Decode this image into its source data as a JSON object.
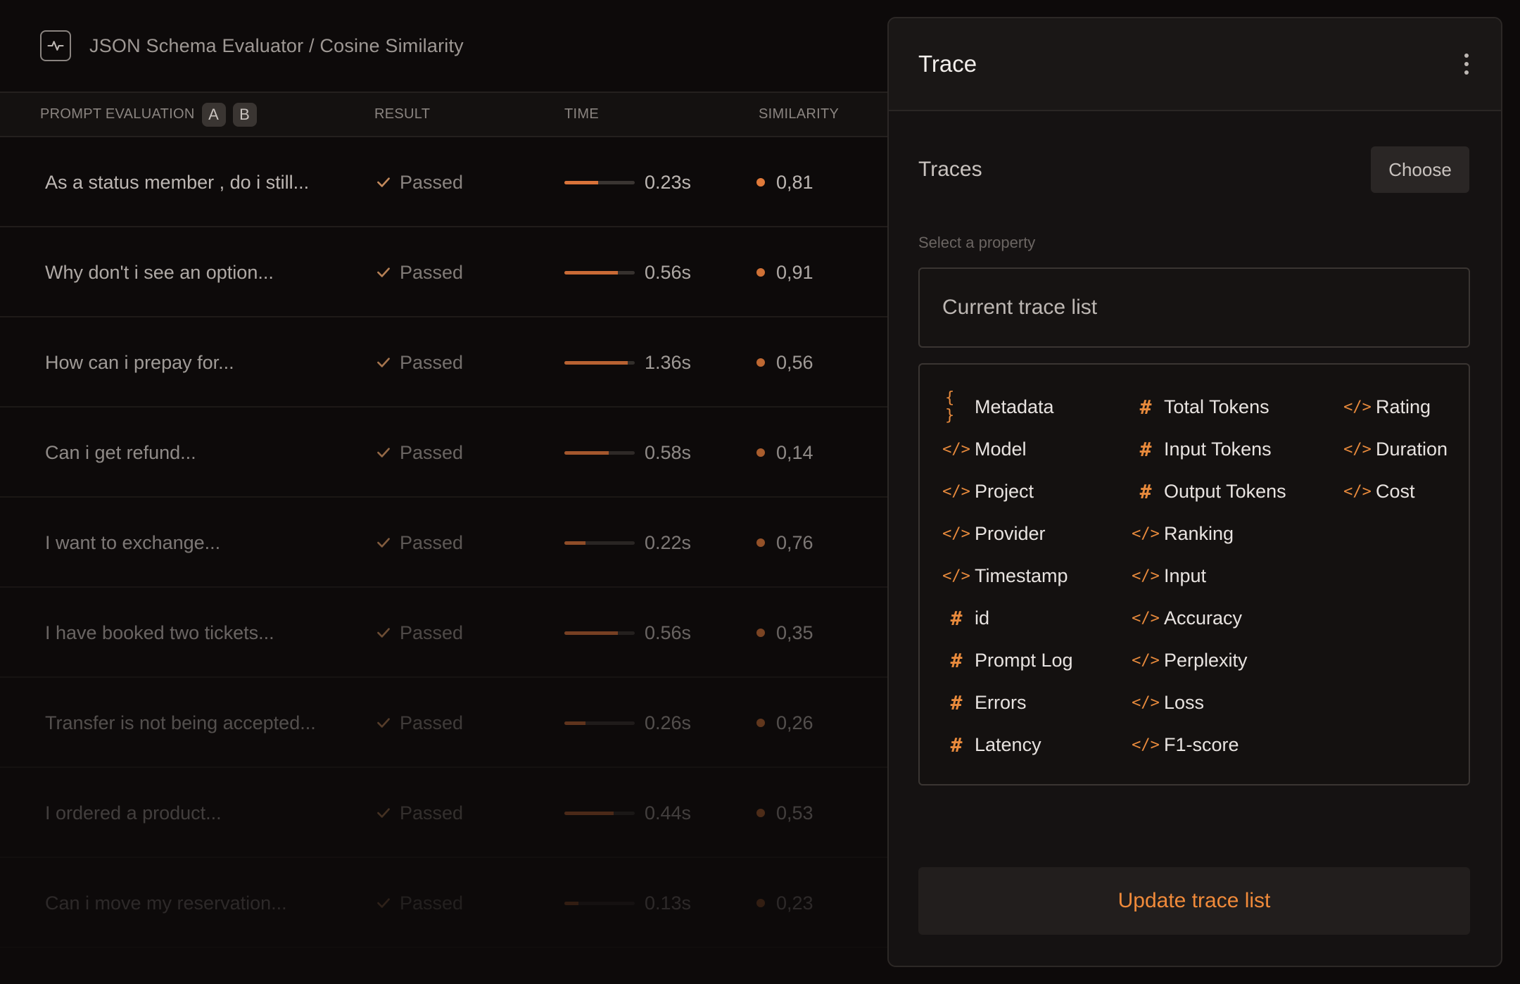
{
  "header": {
    "breadcrumb": "JSON Schema Evaluator / Cosine Similarity"
  },
  "table": {
    "columns": {
      "prompt": "PROMPT EVALUATION",
      "badge_a": "A",
      "badge_b": "B",
      "result": "RESULT",
      "time": "TIME",
      "similarity": "SIMILARITY"
    },
    "rows": [
      {
        "prompt": "As a status member , do i still...",
        "result": "Passed",
        "time": "0.23s",
        "bar": 0.48,
        "similarity": "0,81",
        "opacity": 1.0
      },
      {
        "prompt": "Why don't i see an option...",
        "result": "Passed",
        "time": "0.56s",
        "bar": 0.76,
        "similarity": "0,91",
        "opacity": 0.92
      },
      {
        "prompt": "How can i prepay for...",
        "result": "Passed",
        "time": "1.36s",
        "bar": 0.9,
        "similarity": "0,56",
        "opacity": 0.84
      },
      {
        "prompt": "Can i get refund...",
        "result": "Passed",
        "time": "0.58s",
        "bar": 0.63,
        "similarity": "0,14",
        "opacity": 0.74
      },
      {
        "prompt": "I want to exchange...",
        "result": "Passed",
        "time": "0.22s",
        "bar": 0.3,
        "similarity": "0,76",
        "opacity": 0.64
      },
      {
        "prompt": "I have booked two tickets...",
        "result": "Passed",
        "time": "0.56s",
        "bar": 0.76,
        "similarity": "0,35",
        "opacity": 0.52
      },
      {
        "prompt": "Transfer is not being accepted...",
        "result": "Passed",
        "time": "0.26s",
        "bar": 0.3,
        "similarity": "0,26",
        "opacity": 0.4
      },
      {
        "prompt": "I ordered a product...",
        "result": "Passed",
        "time": "0.44s",
        "bar": 0.7,
        "similarity": "0,53",
        "opacity": 0.3
      },
      {
        "prompt": "Can i move my reservation...",
        "result": "Passed",
        "time": "0.13s",
        "bar": 0.2,
        "similarity": "0,23",
        "opacity": 0.18
      }
    ]
  },
  "panel": {
    "title": "Trace",
    "traces_label": "Traces",
    "choose_label": "Choose",
    "select_label": "Select a property",
    "input_placeholder": "Current trace list",
    "update_label": "Update trace list",
    "accent_color": "#f08a3a",
    "properties": [
      {
        "label": "Metadata",
        "icon": "braces-icon",
        "col": 0,
        "row": 0
      },
      {
        "label": "Model",
        "icon": "code-icon",
        "col": 0,
        "row": 1
      },
      {
        "label": "Project",
        "icon": "code-icon",
        "col": 0,
        "row": 2
      },
      {
        "label": "Provider",
        "icon": "code-icon",
        "col": 0,
        "row": 3
      },
      {
        "label": "Timestamp",
        "icon": "code-icon",
        "col": 0,
        "row": 4
      },
      {
        "label": "id",
        "icon": "hash-icon",
        "col": 0,
        "row": 5
      },
      {
        "label": "Prompt Log",
        "icon": "hash-icon",
        "col": 0,
        "row": 6
      },
      {
        "label": "Errors",
        "icon": "hash-icon",
        "col": 0,
        "row": 7
      },
      {
        "label": "Latency",
        "icon": "hash-icon",
        "col": 0,
        "row": 8
      },
      {
        "label": "Total Tokens",
        "icon": "hash-icon",
        "col": 1,
        "row": 0
      },
      {
        "label": "Input Tokens",
        "icon": "hash-icon",
        "col": 1,
        "row": 1
      },
      {
        "label": "Output Tokens",
        "icon": "hash-icon",
        "col": 1,
        "row": 2
      },
      {
        "label": "Ranking",
        "icon": "code-icon",
        "col": 1,
        "row": 3
      },
      {
        "label": "Input",
        "icon": "code-icon",
        "col": 1,
        "row": 4
      },
      {
        "label": "Accuracy",
        "icon": "code-icon",
        "col": 1,
        "row": 5
      },
      {
        "label": "Perplexity",
        "icon": "code-icon",
        "col": 1,
        "row": 6
      },
      {
        "label": "Loss",
        "icon": "code-icon",
        "col": 1,
        "row": 7
      },
      {
        "label": "F1-score",
        "icon": "code-icon",
        "col": 1,
        "row": 8
      },
      {
        "label": "Rating",
        "icon": "code-icon",
        "col": 2,
        "row": 0
      },
      {
        "label": "Duration",
        "icon": "code-icon",
        "col": 2,
        "row": 1
      },
      {
        "label": "Cost",
        "icon": "code-icon",
        "col": 2,
        "row": 2
      }
    ]
  }
}
